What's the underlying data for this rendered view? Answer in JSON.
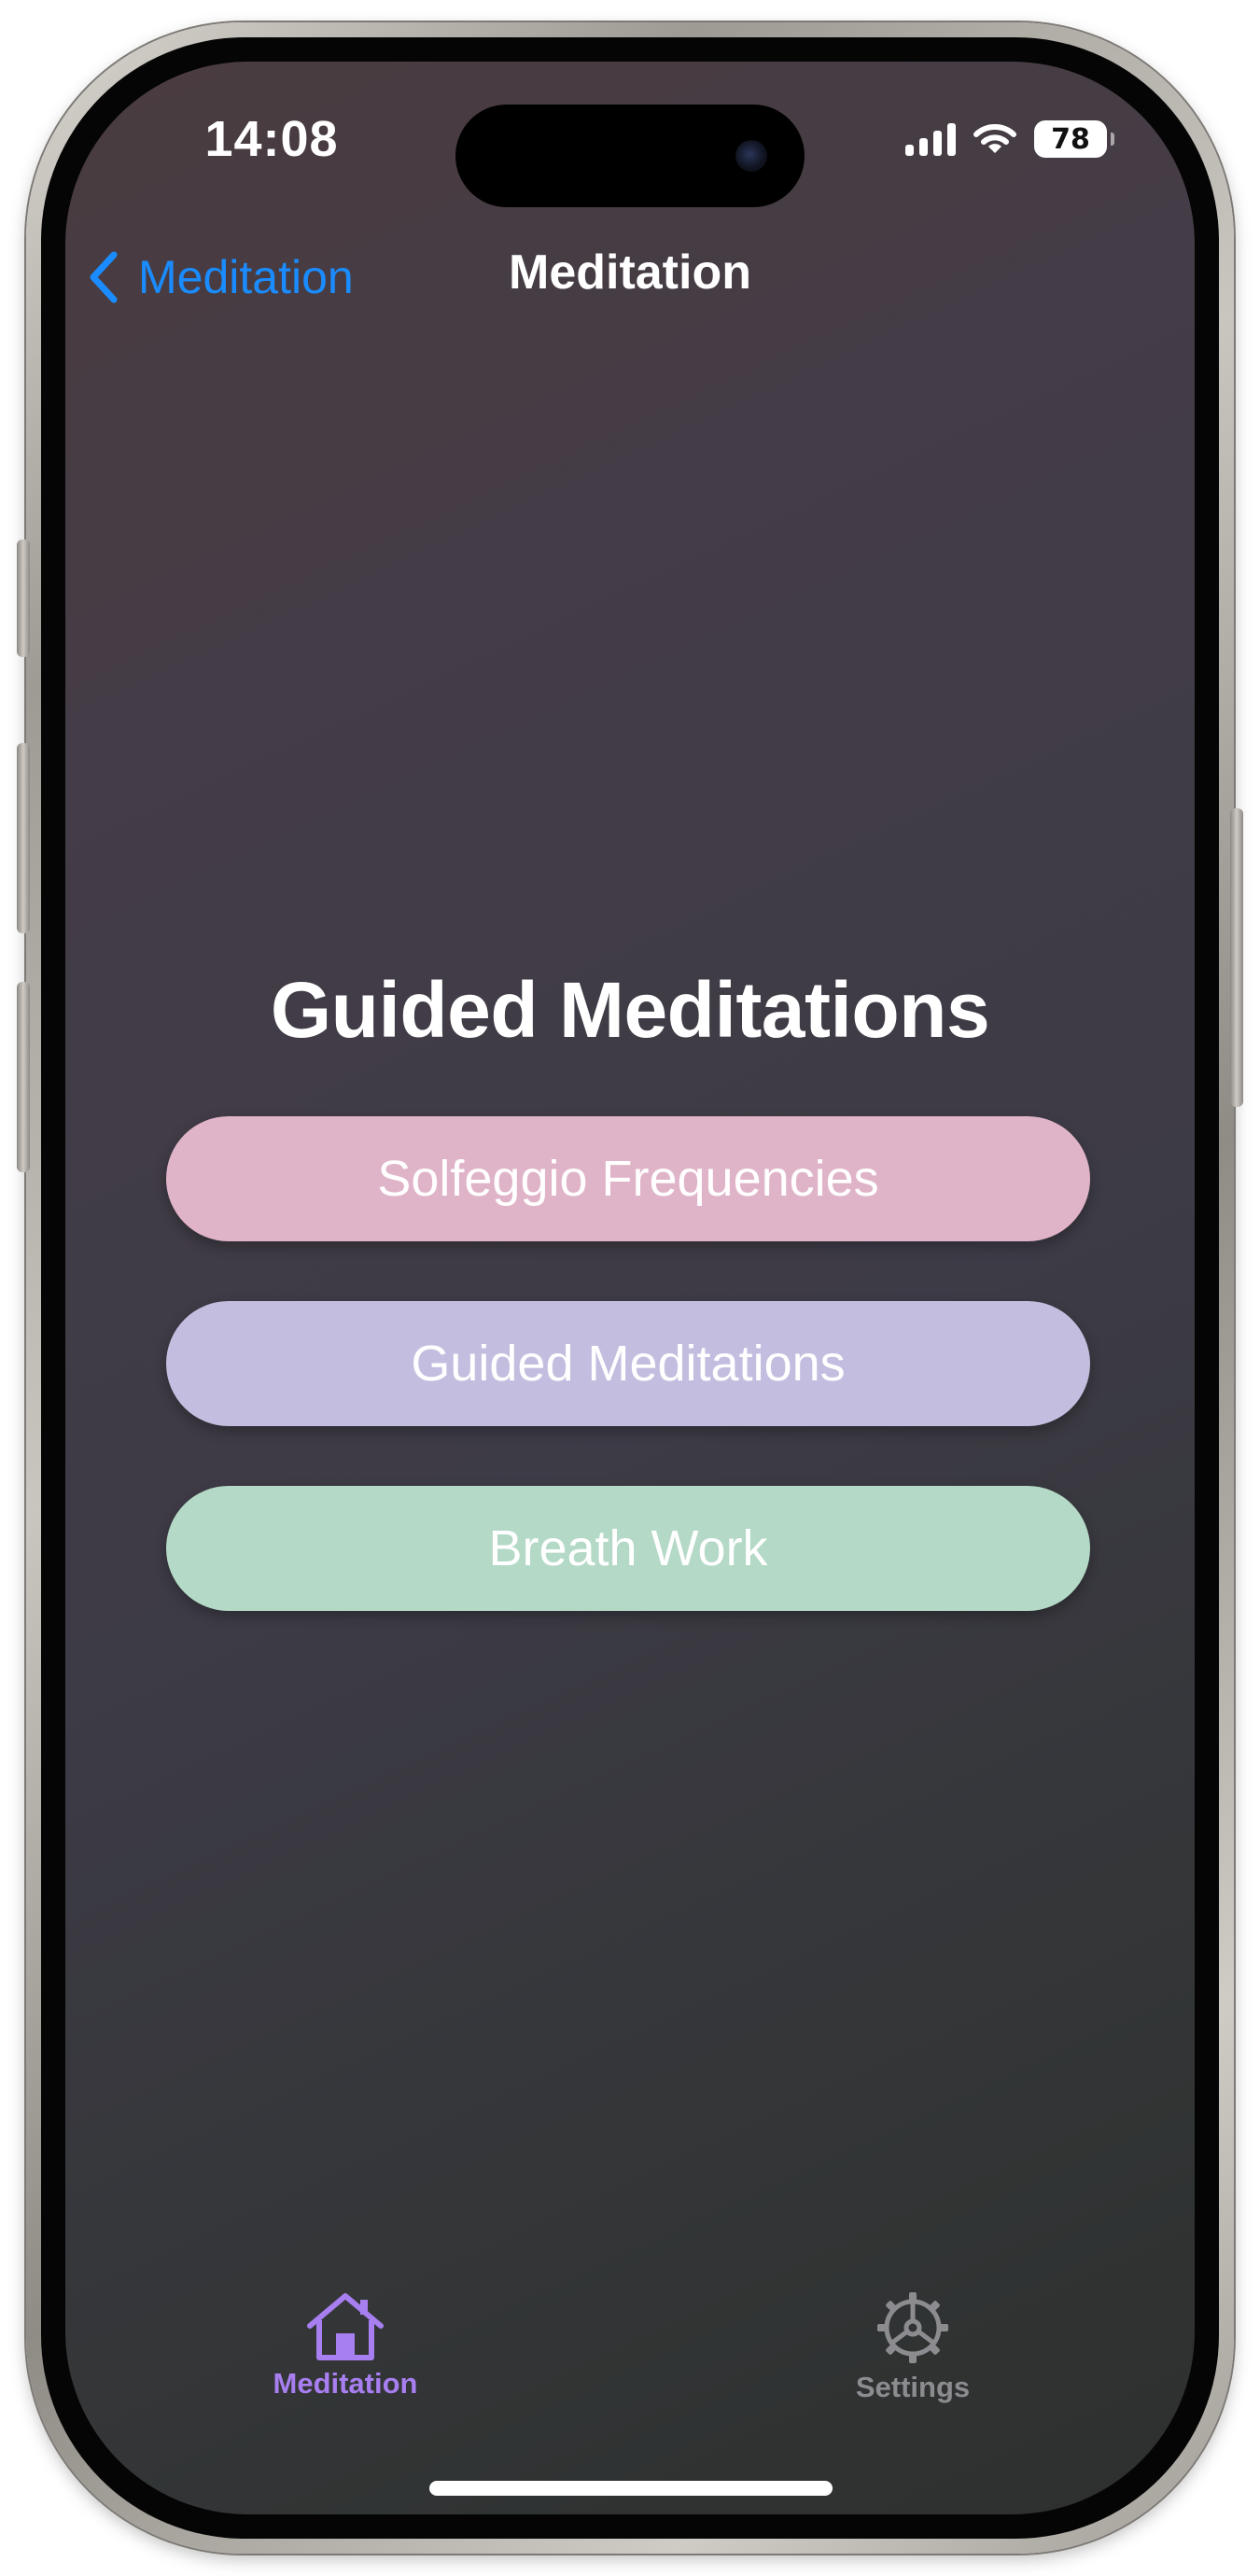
{
  "status_bar": {
    "time": "14:08",
    "battery_level": "78"
  },
  "nav": {
    "back_label": "Meditation",
    "title": "Meditation"
  },
  "main": {
    "heading": "Guided Meditations",
    "buttons": [
      {
        "label": "Solfeggio Frequencies",
        "color": "#e0b4c8"
      },
      {
        "label": "Guided Meditations",
        "color": "#c3bedf"
      },
      {
        "label": "Breath Work",
        "color": "#b4d9c6"
      }
    ]
  },
  "tab_bar": {
    "items": [
      {
        "label": "Meditation",
        "icon": "house-icon",
        "selected": true
      },
      {
        "label": "Settings",
        "icon": "gear-icon",
        "selected": false
      }
    ]
  },
  "colors": {
    "accent_link": "#1a8cff",
    "tab_selected": "#a87ff0",
    "tab_unselected": "#8c8c90"
  }
}
